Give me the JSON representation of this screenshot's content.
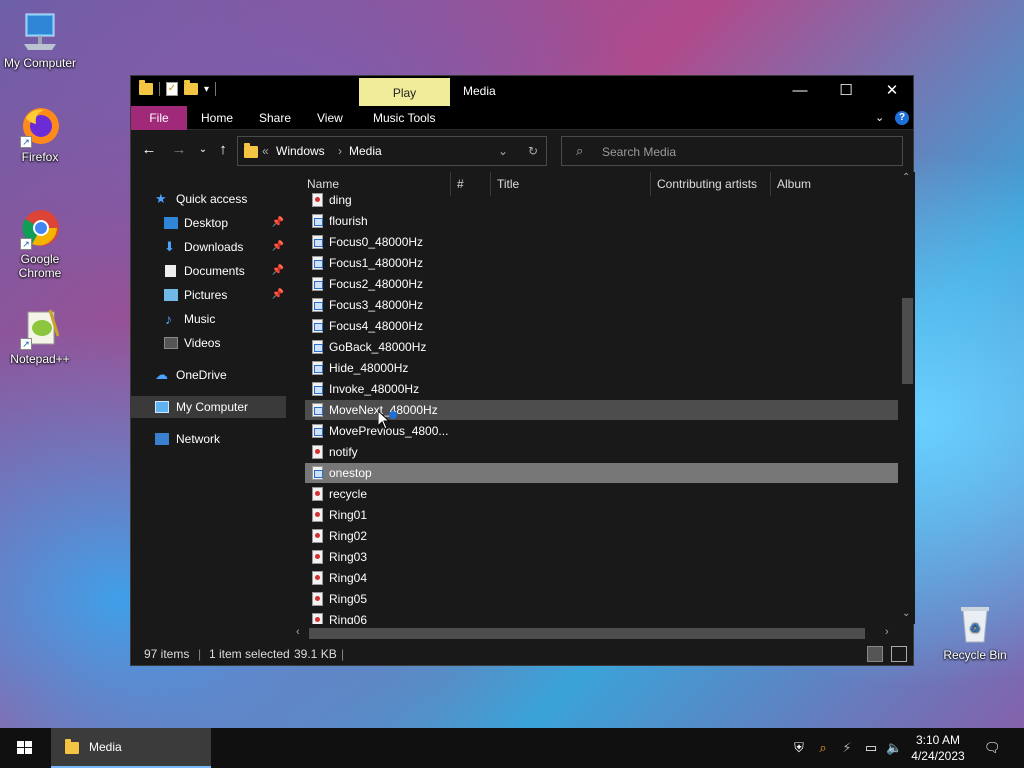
{
  "desktop": {
    "icons": [
      {
        "label": "My Computer"
      },
      {
        "label": "Firefox"
      },
      {
        "label": "Google Chrome"
      },
      {
        "label": "Notepad++"
      },
      {
        "label": "Recycle Bin"
      }
    ]
  },
  "window": {
    "contextual_tab": "Play",
    "title": "Media",
    "ribbon_tabs": [
      "File",
      "Home",
      "Share",
      "View",
      "Music Tools"
    ],
    "address": {
      "overflow": "«",
      "crumbs": [
        "Windows",
        "Media"
      ]
    },
    "search_placeholder": "Search Media",
    "nav_pane": {
      "quick_access": "Quick access",
      "items": [
        {
          "label": "Desktop",
          "pinned": true
        },
        {
          "label": "Downloads",
          "pinned": true
        },
        {
          "label": "Documents",
          "pinned": true
        },
        {
          "label": "Pictures",
          "pinned": true
        },
        {
          "label": "Music",
          "pinned": false
        },
        {
          "label": "Videos",
          "pinned": false
        }
      ],
      "onedrive": "OneDrive",
      "my_computer": "My Computer",
      "network": "Network"
    },
    "columns": [
      "Name",
      "#",
      "Title",
      "Contributing artists",
      "Album"
    ],
    "files": [
      {
        "name": "ding",
        "kind": "snd",
        "state": ""
      },
      {
        "name": "flourish",
        "kind": "wav",
        "state": ""
      },
      {
        "name": "Focus0_48000Hz",
        "kind": "wav",
        "state": ""
      },
      {
        "name": "Focus1_48000Hz",
        "kind": "wav",
        "state": ""
      },
      {
        "name": "Focus2_48000Hz",
        "kind": "wav",
        "state": ""
      },
      {
        "name": "Focus3_48000Hz",
        "kind": "wav",
        "state": ""
      },
      {
        "name": "Focus4_48000Hz",
        "kind": "wav",
        "state": ""
      },
      {
        "name": "GoBack_48000Hz",
        "kind": "wav",
        "state": ""
      },
      {
        "name": "Hide_48000Hz",
        "kind": "wav",
        "state": ""
      },
      {
        "name": "Invoke_48000Hz",
        "kind": "wav",
        "state": ""
      },
      {
        "name": "MoveNext_48000Hz",
        "kind": "wav",
        "state": "hover"
      },
      {
        "name": "MovePrevious_4800...",
        "kind": "wav",
        "state": ""
      },
      {
        "name": "notify",
        "kind": "snd",
        "state": ""
      },
      {
        "name": "onestop",
        "kind": "wav",
        "state": "selected"
      },
      {
        "name": "recycle",
        "kind": "snd",
        "state": ""
      },
      {
        "name": "Ring01",
        "kind": "snd",
        "state": ""
      },
      {
        "name": "Ring02",
        "kind": "snd",
        "state": ""
      },
      {
        "name": "Ring03",
        "kind": "snd",
        "state": ""
      },
      {
        "name": "Ring04",
        "kind": "snd",
        "state": ""
      },
      {
        "name": "Ring05",
        "kind": "snd",
        "state": ""
      },
      {
        "name": "Ring06",
        "kind": "snd",
        "state": ""
      }
    ],
    "status": {
      "items": "97 items",
      "selected": "1 item selected",
      "size": "39.1 KB"
    }
  },
  "taskbar": {
    "app_label": "Media",
    "time": "3:10 AM",
    "date": "4/24/2023"
  },
  "colors": {
    "file_tab": "#a0297a",
    "contextual_tab": "#f0ec9a",
    "accent": "#1e6fd9"
  }
}
